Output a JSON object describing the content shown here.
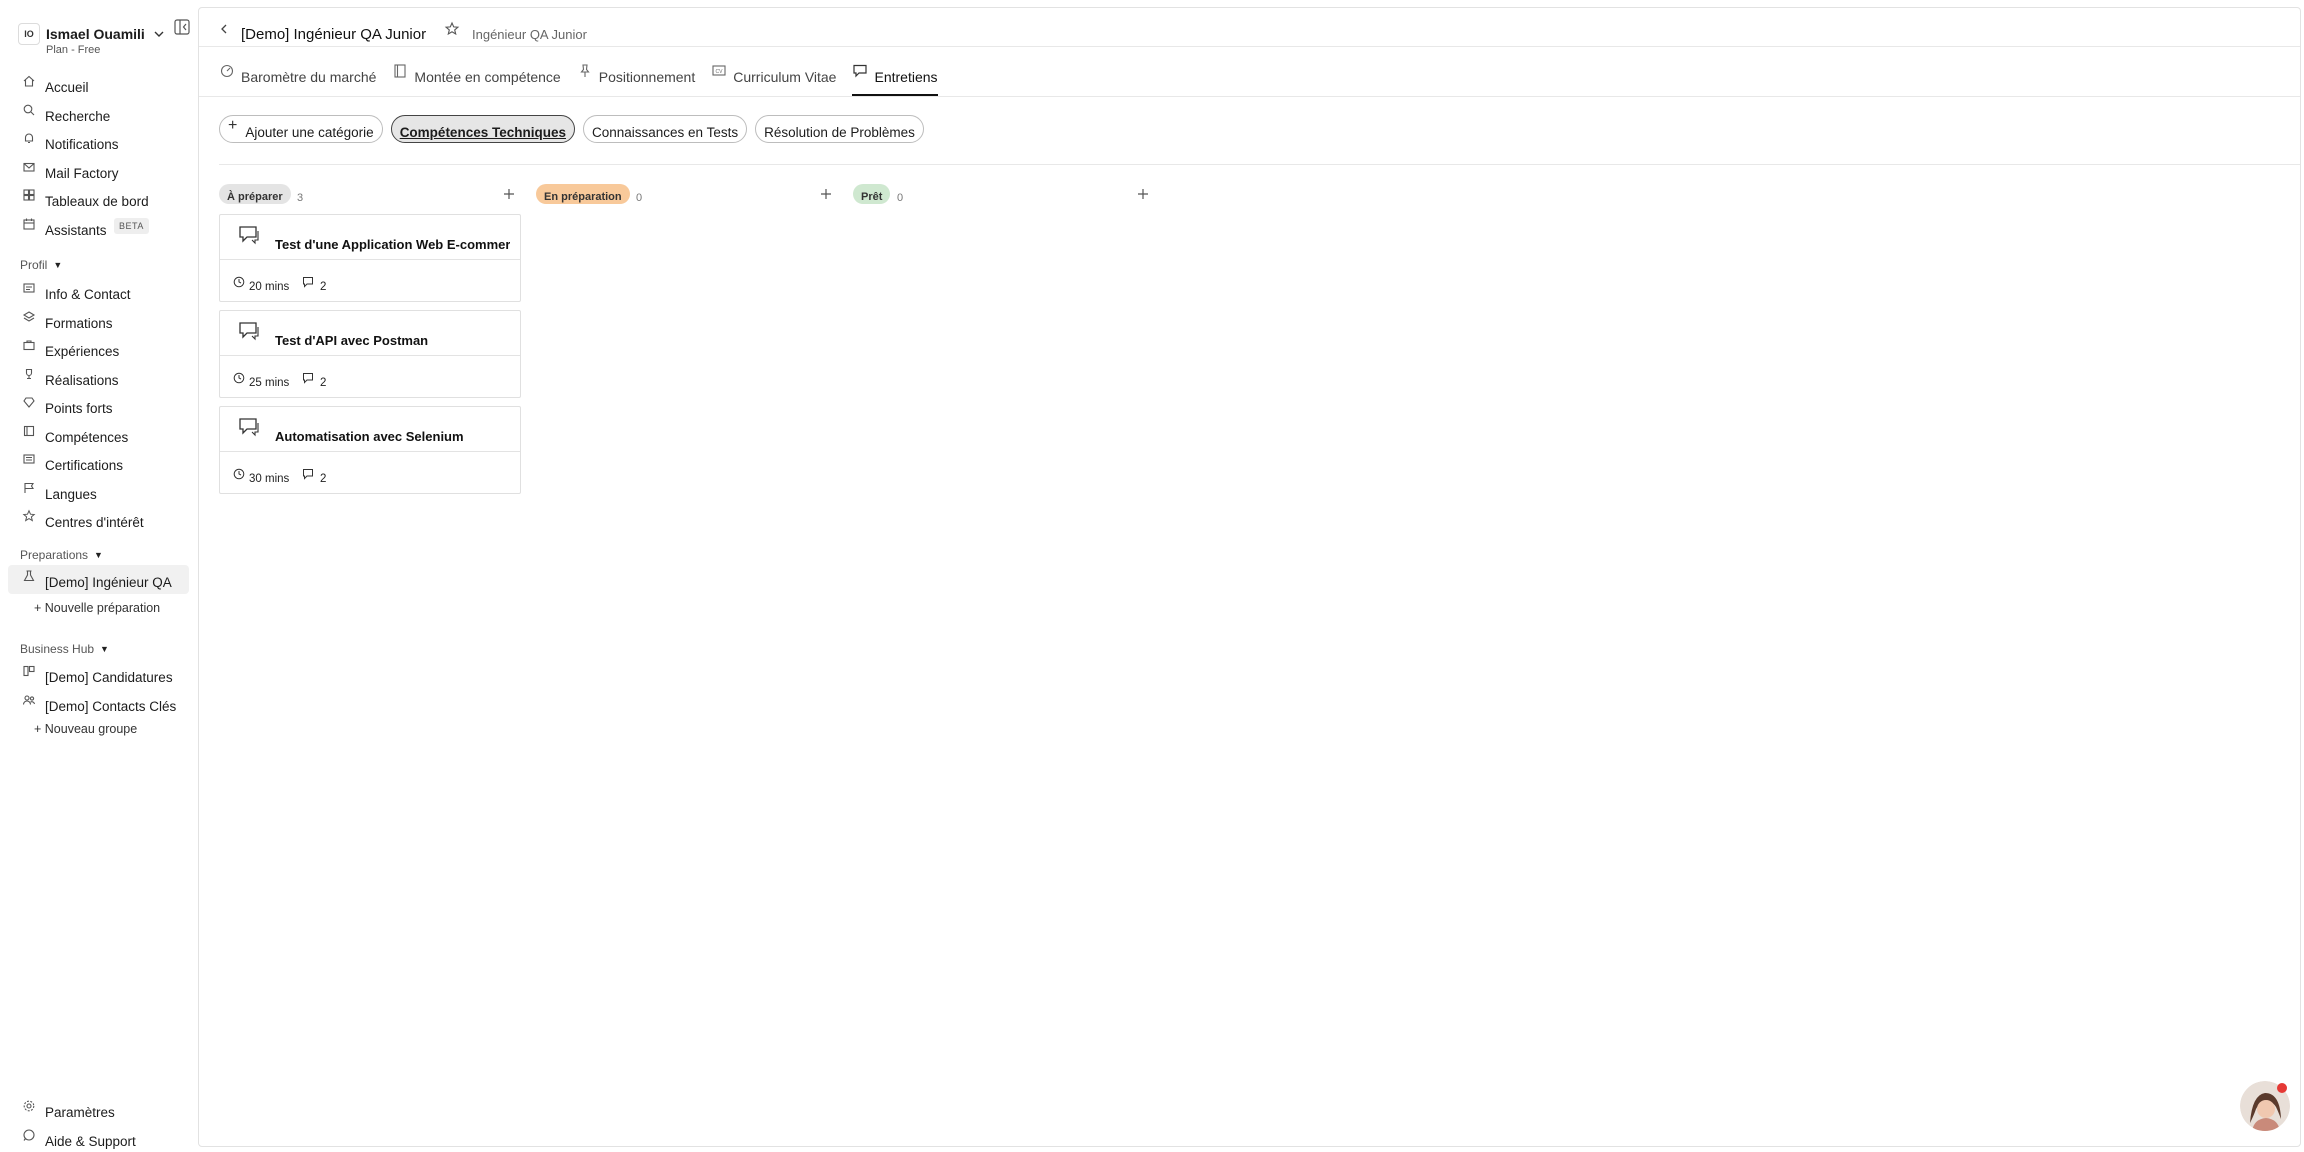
{
  "user": {
    "initials": "IO",
    "name": "Ismael Ouamili",
    "plan": "Plan - Free"
  },
  "nav": [
    {
      "label": "Accueil",
      "icon": "home-icon"
    },
    {
      "label": "Recherche",
      "icon": "search-icon"
    },
    {
      "label": "Notifications",
      "icon": "bell-icon"
    },
    {
      "label": "Mail Factory",
      "icon": "mail-icon"
    },
    {
      "label": "Tableaux de bord",
      "icon": "grid-icon"
    },
    {
      "label": "Assistants",
      "icon": "calendar-icon",
      "badge": "BETA"
    }
  ],
  "profile": {
    "title": "Profil",
    "items": [
      {
        "label": "Info & Contact",
        "icon": "contact-card-icon"
      },
      {
        "label": "Formations",
        "icon": "layers-icon"
      },
      {
        "label": "Expériences",
        "icon": "briefcase-icon"
      },
      {
        "label": "Réalisations",
        "icon": "trophy-icon"
      },
      {
        "label": "Points forts",
        "icon": "gem-icon"
      },
      {
        "label": "Compétences",
        "icon": "book-icon"
      },
      {
        "label": "Certifications",
        "icon": "certificate-icon"
      },
      {
        "label": "Langues",
        "icon": "flag-icon"
      },
      {
        "label": "Centres d'intérêt",
        "icon": "star-icon"
      }
    ]
  },
  "preparations": {
    "title": "Preparations",
    "active_item": "[Demo] Ingénieur QA",
    "new_link": "+ Nouvelle préparation"
  },
  "business": {
    "title": "Business Hub",
    "items": [
      {
        "label": "[Demo] Candidatures",
        "icon": "board-icon"
      },
      {
        "label": "[Demo] Contacts Clés",
        "icon": "people-icon"
      }
    ],
    "new_link": "+ Nouveau groupe"
  },
  "footer": {
    "settings": "Paramètres",
    "help": "Aide & Support"
  },
  "header": {
    "title": "[Demo] Ingénieur QA Junior",
    "subtitle": "Ingénieur QA Junior"
  },
  "tabs": [
    {
      "label": "Baromètre du marché",
      "icon": "gauge-icon"
    },
    {
      "label": "Montée en compétence",
      "icon": "notebook-icon"
    },
    {
      "label": "Positionnement",
      "icon": "pin-icon"
    },
    {
      "label": "Curriculum Vitae",
      "icon": "cv-icon"
    },
    {
      "label": "Entretiens",
      "icon": "chat-icon",
      "active": true
    }
  ],
  "pills": {
    "add": "Ajouter une catégorie",
    "items": [
      {
        "label": "Compétences Techniques",
        "active": true
      },
      {
        "label": "Connaissances en Tests"
      },
      {
        "label": "Résolution de Problèmes"
      }
    ]
  },
  "columns": [
    {
      "label": "À préparer",
      "count": "3",
      "color": "#e4e4e4"
    },
    {
      "label": "En préparation",
      "count": "0",
      "color": "#f8c99a"
    },
    {
      "label": "Prêt",
      "count": "0",
      "color": "#cfe8d0"
    }
  ],
  "cards": [
    {
      "title": "Test d'une Application Web E-commerce",
      "duration": "20 mins",
      "comments": "2"
    },
    {
      "title": "Test d'API avec Postman",
      "duration": "25 mins",
      "comments": "2"
    },
    {
      "title": "Automatisation avec Selenium",
      "duration": "30 mins",
      "comments": "2"
    }
  ]
}
